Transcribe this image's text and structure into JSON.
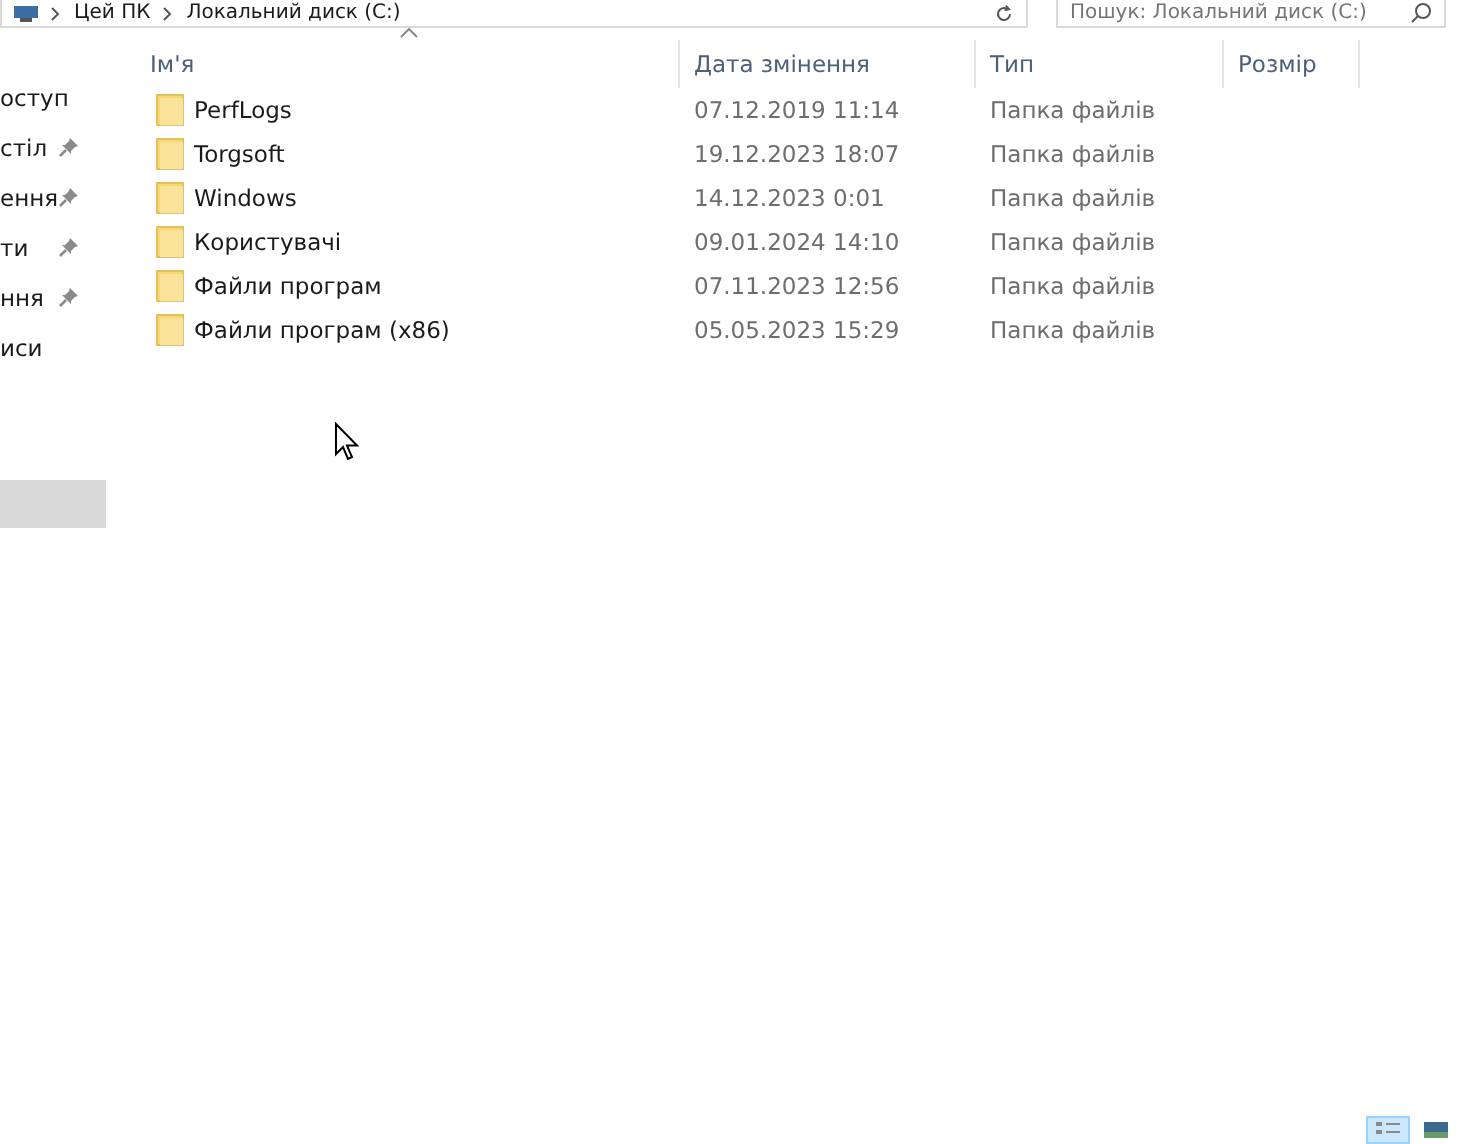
{
  "address_bar": {
    "path": [
      {
        "label": "Цей ПК"
      },
      {
        "label": "Локальний диск (C:)"
      }
    ]
  },
  "search": {
    "placeholder": "Пошук: Локальний диск (C:)"
  },
  "sidebar": {
    "items": [
      {
        "label": "оступ",
        "pinned": false,
        "selected": false
      },
      {
        "label": "стіл",
        "pinned": true,
        "selected": false
      },
      {
        "label": "ення",
        "pinned": true,
        "selected": false
      },
      {
        "label": "ти",
        "pinned": true,
        "selected": false
      },
      {
        "label": "ння",
        "pinned": true,
        "selected": false
      },
      {
        "label": "иси",
        "pinned": false,
        "selected": false
      },
      {
        "pinned": false,
        "selected": true
      }
    ]
  },
  "table": {
    "columns": [
      {
        "label": "Ім'я",
        "sorted": true
      },
      {
        "label": "Дата змінення",
        "sorted": false
      },
      {
        "label": "Тип",
        "sorted": false
      },
      {
        "label": "Розмір",
        "sorted": false
      }
    ],
    "rows": [
      {
        "name": "PerfLogs",
        "date": "07.12.2019 11:14",
        "type": "Папка файлів"
      },
      {
        "name": "Torgsoft",
        "date": "19.12.2023 18:07",
        "type": "Папка файлів"
      },
      {
        "name": "Windows",
        "date": "14.12.2023 0:01",
        "type": "Папка файлів"
      },
      {
        "name": "Користувачі",
        "date": "09.01.2024 14:10",
        "type": "Папка файлів"
      },
      {
        "name": "Файли програм",
        "date": "07.11.2023 12:56",
        "type": "Папка файлів"
      },
      {
        "name": "Файли програм (x86)",
        "date": "05.05.2023 15:29",
        "type": "Папка файлів"
      }
    ]
  },
  "view_buttons": [
    {
      "kind": "details",
      "selected": true
    },
    {
      "kind": "tiles",
      "selected": false
    }
  ]
}
